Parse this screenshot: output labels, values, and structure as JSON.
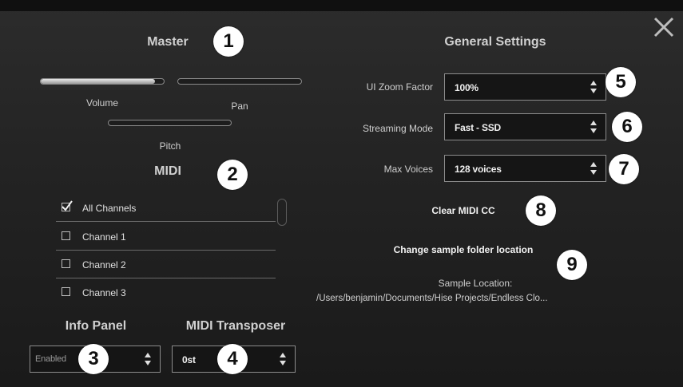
{
  "master": {
    "title": "Master",
    "volume_label": "Volume",
    "volume_level": 0.93,
    "pan_label": "Pan",
    "pan_level": 0.0,
    "pitch_label": "Pitch",
    "pitch_level": 0.0
  },
  "midi": {
    "title": "MIDI",
    "channels": [
      {
        "label": "All Channels",
        "checked": true
      },
      {
        "label": "Channel 1",
        "checked": false
      },
      {
        "label": "Channel 2",
        "checked": false
      },
      {
        "label": "Channel 3",
        "checked": false
      }
    ]
  },
  "info_panel": {
    "title": "Info Panel",
    "value": "Enabled"
  },
  "midi_transposer": {
    "title": "MIDI Transposer",
    "value": "0st"
  },
  "general": {
    "title": "General Settings",
    "ui_zoom_label": "UI Zoom Factor",
    "ui_zoom_value": "100%",
    "streaming_label": "Streaming Mode",
    "streaming_value": "Fast - SSD",
    "max_voices_label": "Max Voices",
    "max_voices_value": "128 voices",
    "clear_midi_cc": "Clear MIDI CC",
    "change_sample_folder": "Change sample folder location",
    "sample_location_label": "Sample Location:",
    "sample_location_path": "/Users/benjamin/Documents/Hise Projects/Endless Clo..."
  },
  "badges": [
    "1",
    "2",
    "3",
    "4",
    "5",
    "6",
    "7",
    "8",
    "9"
  ],
  "colors": {
    "background": "#232323",
    "badge_bg": "#ffffff",
    "badge_text": "#111111",
    "text": "#e6e6e6"
  },
  "icons": {
    "close": "close-icon",
    "combo_arrows": "up-down-arrows-icon",
    "check": "checkmark-icon"
  }
}
